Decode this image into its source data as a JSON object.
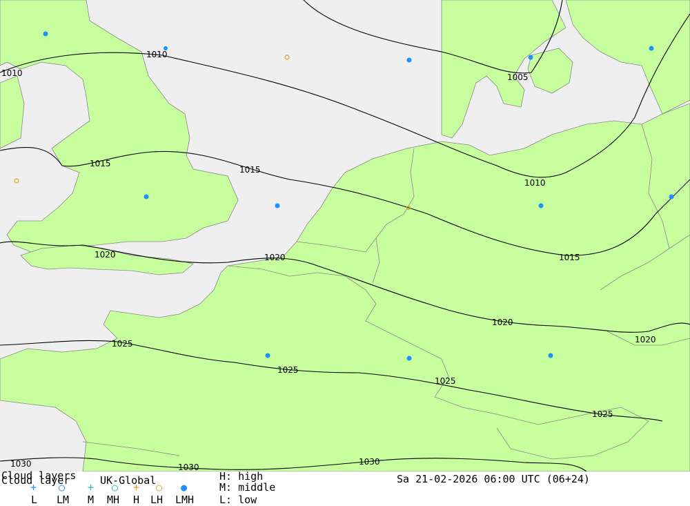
{
  "title": "Cloud layer",
  "title_overlap": "Cloud layers",
  "model": "UK-Global",
  "datetime": "Sa 21-02-2026 06:00 UTC (06+24)",
  "legend_items": [
    {
      "symbol": "+",
      "label": "L",
      "color": "#1e90ff"
    },
    {
      "symbol": "○",
      "label": "LM",
      "color": "#1e90ff"
    },
    {
      "symbol": "+",
      "label": "M",
      "color": "#20c0b0"
    },
    {
      "symbol": "○",
      "label": "MH",
      "color": "#20c0b0"
    },
    {
      "symbol": "+",
      "label": "H",
      "color": "#e0a020"
    },
    {
      "symbol": "○",
      "label": "LH",
      "color": "#e0a020"
    },
    {
      "symbol": "●",
      "label": "LMH",
      "color": "#1e90ff"
    }
  ],
  "key": {
    "high": "H: high",
    "middle": "M: middle",
    "low": "L: low"
  },
  "isobars": [
    "1005",
    "1010",
    "1015",
    "1020",
    "1025",
    "1030"
  ],
  "colors": {
    "land": "#c8ff9e",
    "sea": "#efefef",
    "isobar": "#000000",
    "border": "#888888",
    "lmh_dot": "#1e90ff",
    "high_marker": "#e0a020"
  }
}
